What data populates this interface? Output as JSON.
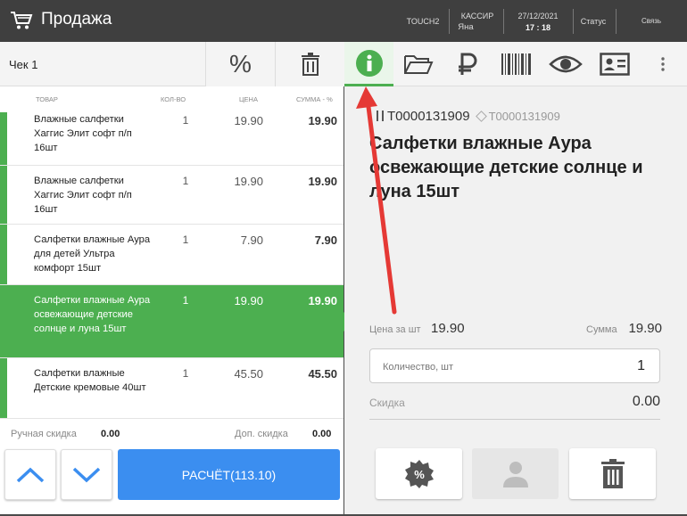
{
  "header": {
    "title": "Продажа",
    "terminal": "TOUCH2",
    "cashier_label": "КАССИР",
    "cashier_name": "Яна",
    "date": "27/12/2021",
    "time": "17 : 18",
    "status": "Статус",
    "connection": "Связь"
  },
  "check": {
    "label": "Чек 1",
    "discount_button_symbol": "%"
  },
  "columns": {
    "product": "ТОВАР",
    "qty": "КОЛ-ВО",
    "price": "ЦЕНА",
    "sum": "СУММА - %"
  },
  "items": [
    {
      "name": "Влажные салфетки Хаггис Элит софт п/п 16шт",
      "qty": "1",
      "price": "19.90",
      "sum": "19.90",
      "selected": false
    },
    {
      "name": "Влажные салфетки Хаггис Элит софт п/п 16шт",
      "qty": "1",
      "price": "19.90",
      "sum": "19.90",
      "selected": false
    },
    {
      "name": "Салфетки влажные Аура для детей Ультра комфорт 15шт",
      "qty": "1",
      "price": "7.90",
      "sum": "7.90",
      "selected": false
    },
    {
      "name": "Салфетки влажные Аура освежающие детские солнце и луна 15шт",
      "qty": "1",
      "price": "19.90",
      "sum": "19.90",
      "selected": true
    },
    {
      "name": "Салфетки влажные Детские кремовые 40шт",
      "qty": "1",
      "price": "45.50",
      "sum": "45.50",
      "selected": false
    }
  ],
  "footer": {
    "manual_discount_label": "Ручная скидка",
    "manual_discount_value": "0.00",
    "extra_discount_label": "Доп. скидка",
    "extra_discount_value": "0.00",
    "pay_button": "РАСЧЁТ(113.10)"
  },
  "detail": {
    "barcode": "T0000131909",
    "article": "T0000131909",
    "title": "Салфетки влажные Аура освежающие детские солнце и луна 15шт",
    "price_label": "Цена за шт",
    "price_value": "19.90",
    "sum_label": "Сумма",
    "sum_value": "19.90",
    "qty_label": "Количество, шт",
    "qty_value": "1",
    "discount_label": "Скидка",
    "discount_value": "0.00"
  },
  "toolbar_icons": [
    "info-icon",
    "folder-icon",
    "ruble-icon",
    "barcode-icon",
    "eye-icon",
    "id-card-icon",
    "more-icon"
  ],
  "colors": {
    "accent_green": "#4caf50",
    "pay_blue": "#3b8ef0",
    "topbar": "#3f3f3f",
    "annotation_red": "#e53935"
  }
}
